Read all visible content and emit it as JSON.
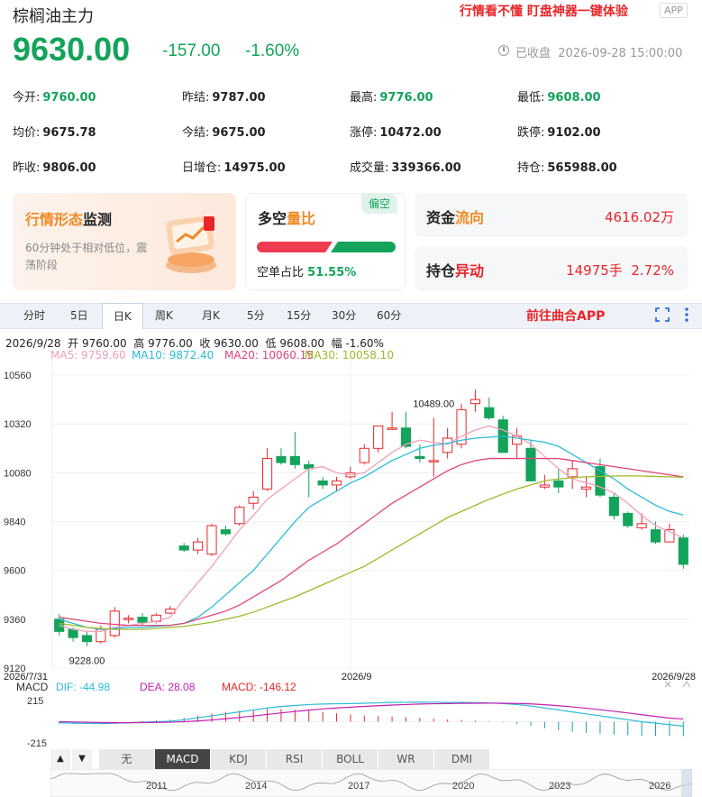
{
  "header": {
    "title": "棕榈油主力",
    "promo": "行情看不懂 盯盘神器一键体验",
    "app_badge": "APP",
    "price": "9630.00",
    "change": "-157.00",
    "change_pct": "-1.60%",
    "status": "已收盘",
    "datetime": "2026-09-28 15:00:00"
  },
  "stats": [
    {
      "label": "今开:",
      "value": "9760.00",
      "color": "green"
    },
    {
      "label": "昨结:",
      "value": "9787.00",
      "color": "dark"
    },
    {
      "label": "最高:",
      "value": "9776.00",
      "color": "green"
    },
    {
      "label": "最低:",
      "value": "9608.00",
      "color": "green"
    },
    {
      "label": "均价:",
      "value": "9675.78",
      "color": "dark"
    },
    {
      "label": "今结:",
      "value": "9675.00",
      "color": "dark"
    },
    {
      "label": "涨停:",
      "value": "10472.00",
      "color": "dark"
    },
    {
      "label": "跌停:",
      "value": "9102.00",
      "color": "dark"
    },
    {
      "label": "昨收:",
      "value": "9806.00",
      "color": "dark"
    },
    {
      "label": "日增仓:",
      "value": "14975.00",
      "color": "dark"
    },
    {
      "label": "成交量:",
      "value": "339366.00",
      "color": "dark"
    },
    {
      "label": "持仓:",
      "value": "565988.00",
      "color": "dark"
    }
  ],
  "cards": {
    "monitor": {
      "title_a": "行情形态",
      "title_b": "监测",
      "desc": "60分钟处于相对低位，震荡阶段"
    },
    "ratio": {
      "title_a": "多空",
      "title_b": "量比",
      "badge": "偏空",
      "short_label": "空单占比",
      "short_value": "51.55%"
    },
    "flow": {
      "title_a": "资金",
      "title_b": "流向",
      "value": "4616.02万"
    },
    "position": {
      "title_a": "持仓",
      "title_b": "异动",
      "value": "14975手",
      "pct": "2.72%"
    }
  },
  "tabs": [
    "分时",
    "5日",
    "日K",
    "周K",
    "月K",
    "5分",
    "15分",
    "30分",
    "60分"
  ],
  "active_tab": "日K",
  "go_app": "前往曲合APP",
  "ohlc_line": {
    "date": "2026/9/28",
    "open_label": "开",
    "open": "9760.00",
    "high_label": "高",
    "high": "9776.00",
    "close_label": "收",
    "close": "9630.00",
    "low_label": "低",
    "low": "9608.00",
    "amp_label": "幅",
    "amp": "-1.60%"
  },
  "ma_legend": [
    {
      "label": "MA5: 9759.60",
      "color": "#f2a0b8"
    },
    {
      "label": "MA10: 9872.40",
      "color": "#2bbcd8"
    },
    {
      "label": "MA20: 10060.15",
      "color": "#e0457b"
    },
    {
      "label": "MA30: 10058.10",
      "color": "#a0b82a"
    }
  ],
  "macd_legend": {
    "name": "MACD",
    "dif": "DIF: -44.98",
    "dea": "DEA: 28.08",
    "macd": "MACD: -146.12"
  },
  "indicator_tabs": [
    "无",
    "MACD",
    "KDJ",
    "RSI",
    "BOLL",
    "WR",
    "DMI"
  ],
  "active_indicator": "MACD",
  "overview_years": [
    "2011",
    "2014",
    "2017",
    "2020",
    "2023",
    "2026"
  ],
  "colors": {
    "up": "#e8262a",
    "down": "#13a35a",
    "green_text": "#13a35a"
  },
  "chart_data": {
    "type": "candlestick",
    "title": "",
    "y_ticks": [
      10560,
      10320,
      10080,
      9840,
      9600,
      9360,
      9120
    ],
    "ylim": [
      9120,
      10640
    ],
    "x_labels": [
      "2026/7/31",
      "2026/9",
      "2026/9/28"
    ],
    "annotations": [
      {
        "text": "10489.00",
        "index": 27
      },
      {
        "text": "9228.00",
        "index": 2
      }
    ],
    "candles": [
      [
        9360,
        9385,
        9280,
        9300
      ],
      [
        9310,
        9320,
        9250,
        9270
      ],
      [
        9280,
        9300,
        9228,
        9250
      ],
      [
        9250,
        9330,
        9240,
        9310
      ],
      [
        9280,
        9420,
        9270,
        9400
      ],
      [
        9360,
        9380,
        9340,
        9365
      ],
      [
        9370,
        9390,
        9330,
        9345
      ],
      [
        9350,
        9390,
        9340,
        9380
      ],
      [
        9390,
        9425,
        9385,
        9410
      ],
      [
        9720,
        9735,
        9690,
        9700
      ],
      [
        9700,
        9760,
        9680,
        9740
      ],
      [
        9680,
        9830,
        9670,
        9820
      ],
      [
        9800,
        9820,
        9770,
        9780
      ],
      [
        9830,
        9920,
        9820,
        9910
      ],
      [
        9930,
        9990,
        9900,
        9960
      ],
      [
        10000,
        10200,
        9990,
        10150
      ],
      [
        10160,
        10200,
        10120,
        10130
      ],
      [
        10160,
        10280,
        10100,
        10120
      ],
      [
        10120,
        10140,
        9960,
        10100
      ],
      [
        10040,
        10060,
        10000,
        10020
      ],
      [
        10020,
        10060,
        9990,
        10040
      ],
      [
        10060,
        10110,
        10050,
        10080
      ],
      [
        10130,
        10220,
        10120,
        10200
      ],
      [
        10200,
        10310,
        10180,
        10310
      ],
      [
        10300,
        10380,
        10290,
        10300
      ],
      [
        10300,
        10380,
        10200,
        10210
      ],
      [
        10160,
        10220,
        10130,
        10150
      ],
      [
        10140,
        10350,
        10060,
        10140
      ],
      [
        10180,
        10300,
        10150,
        10250
      ],
      [
        10220,
        10420,
        10200,
        10390
      ],
      [
        10420,
        10489,
        10380,
        10440
      ],
      [
        10400,
        10450,
        10340,
        10350
      ],
      [
        10340,
        10360,
        10180,
        10180
      ],
      [
        10220,
        10300,
        10150,
        10260
      ],
      [
        10200,
        10240,
        10040,
        10040
      ],
      [
        10010,
        10070,
        10000,
        10020
      ],
      [
        10040,
        10100,
        9980,
        10010
      ],
      [
        10060,
        10140,
        10000,
        10100
      ],
      [
        10000,
        10060,
        9960,
        10010
      ],
      [
        10110,
        10150,
        9960,
        9970
      ],
      [
        9960,
        9980,
        9850,
        9870
      ],
      [
        9880,
        9890,
        9810,
        9820
      ],
      [
        9810,
        9880,
        9800,
        9830
      ],
      [
        9800,
        9840,
        9730,
        9740
      ],
      [
        9740,
        9830,
        9740,
        9800
      ],
      [
        9760,
        9776,
        9608,
        9630
      ]
    ],
    "ma5": [
      9330,
      9310,
      9300,
      9300,
      9320,
      9330,
      9340,
      9350,
      9370,
      9460,
      9540,
      9620,
      9710,
      9800,
      9870,
      9950,
      10000,
      10050,
      10100,
      10110,
      10080,
      10070,
      10080,
      10130,
      10180,
      10220,
      10240,
      10230,
      10220,
      10260,
      10290,
      10310,
      10290,
      10260,
      10220,
      10160,
      10100,
      10050,
      10030,
      10010,
      9980,
      9930,
      9870,
      9820,
      9790,
      9760
    ],
    "ma10": [
      9360,
      9340,
      9320,
      9310,
      9315,
      9320,
      9320,
      9325,
      9330,
      9340,
      9370,
      9420,
      9480,
      9540,
      9600,
      9680,
      9760,
      9840,
      9910,
      9950,
      9990,
      10030,
      10060,
      10100,
      10140,
      10170,
      10200,
      10215,
      10225,
      10240,
      10250,
      10255,
      10260,
      10250,
      10240,
      10230,
      10210,
      10170,
      10130,
      10090,
      10050,
      10000,
      9960,
      9920,
      9890,
      9872
    ],
    "ma20": [
      9370,
      9360,
      9350,
      9340,
      9335,
      9330,
      9330,
      9330,
      9330,
      9340,
      9360,
      9380,
      9400,
      9430,
      9470,
      9510,
      9550,
      9600,
      9650,
      9690,
      9730,
      9780,
      9830,
      9880,
      9930,
      9970,
      10010,
      10050,
      10090,
      10120,
      10140,
      10150,
      10150,
      10150,
      10150,
      10150,
      10150,
      10140,
      10130,
      10120,
      10110,
      10100,
      10090,
      10080,
      10070,
      10060
    ],
    "ma30": [
      9340,
      9330,
      9320,
      9315,
      9310,
      9310,
      9310,
      9315,
      9320,
      9325,
      9335,
      9345,
      9360,
      9375,
      9395,
      9420,
      9445,
      9470,
      9500,
      9530,
      9560,
      9590,
      9620,
      9660,
      9700,
      9740,
      9780,
      9820,
      9860,
      9890,
      9920,
      9950,
      9975,
      10000,
      10020,
      10040,
      10050,
      10055,
      10060,
      10062,
      10064,
      10065,
      10064,
      10062,
      10060,
      10058
    ],
    "macd_ylim": [
      -280,
      280
    ],
    "macd_ticks": [
      215,
      -215
    ],
    "dif": [
      -10,
      -15,
      -18,
      -20,
      -15,
      -10,
      -5,
      0,
      5,
      20,
      40,
      60,
      80,
      100,
      120,
      140,
      155,
      165,
      175,
      180,
      183,
      185,
      188,
      192,
      196,
      198,
      200,
      199,
      197,
      196,
      194,
      192,
      185,
      175,
      160,
      140,
      120,
      100,
      80,
      60,
      40,
      20,
      0,
      -15,
      -30,
      -45
    ],
    "dea": [
      0,
      -3,
      -6,
      -9,
      -10,
      -10,
      -9,
      -7,
      -5,
      0,
      8,
      18,
      30,
      44,
      58,
      74,
      90,
      104,
      118,
      130,
      140,
      148,
      156,
      163,
      170,
      175,
      180,
      183,
      185,
      187,
      188,
      189,
      188,
      186,
      181,
      173,
      163,
      151,
      137,
      122,
      106,
      89,
      71,
      54,
      37,
      28
    ],
    "macd": [
      -20,
      -24,
      -24,
      -22,
      -10,
      0,
      8,
      14,
      20,
      40,
      64,
      84,
      100,
      112,
      124,
      132,
      130,
      122,
      114,
      100,
      86,
      74,
      64,
      58,
      52,
      46,
      40,
      32,
      24,
      18,
      12,
      6,
      -6,
      -22,
      -42,
      -66,
      -86,
      -102,
      -114,
      -124,
      -132,
      -138,
      -142,
      -144,
      -145,
      -146
    ]
  }
}
